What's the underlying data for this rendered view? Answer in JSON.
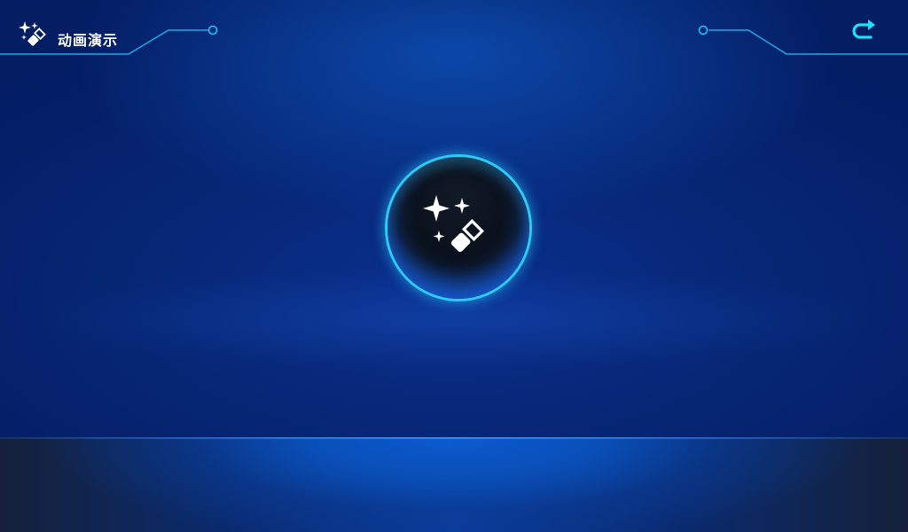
{
  "header": {
    "title": "动画演示",
    "icon": "magic-wand-sparkles-icon",
    "back_icon": "return-arrow-icon"
  },
  "main": {
    "center_icon": "magic-wand-sparkles-icon"
  },
  "colors": {
    "background": "#072777",
    "accent": "#1ec8ff",
    "floor": "#0b5bd0"
  }
}
